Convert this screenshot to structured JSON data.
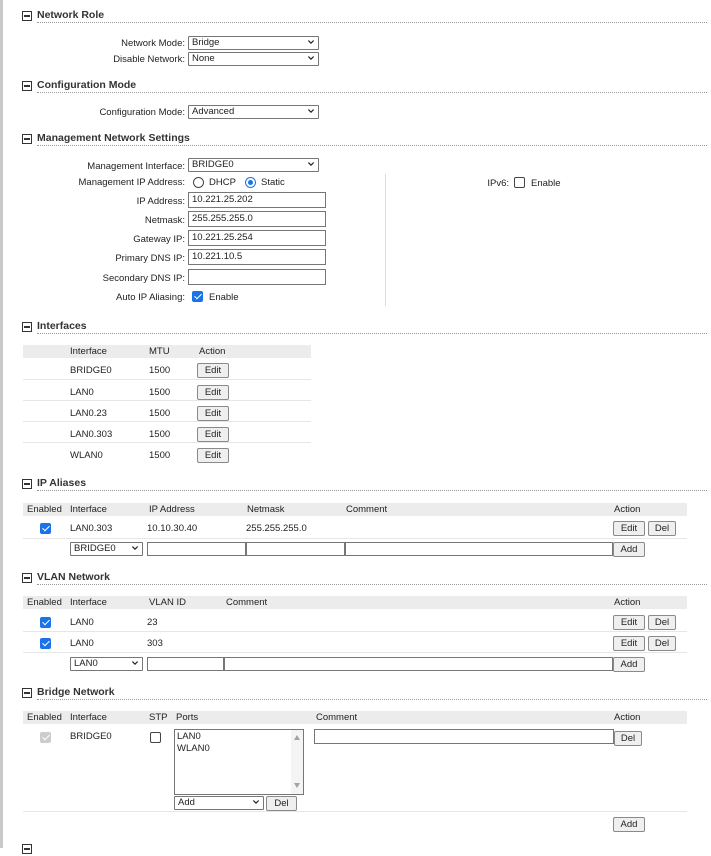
{
  "sections": {
    "network_role": "Network Role",
    "configuration_mode": "Configuration Mode",
    "management": "Management Network Settings",
    "interfaces": "Interfaces",
    "ip_aliases": "IP Aliases",
    "vlan": "VLAN Network",
    "bridge": "Bridge Network"
  },
  "network_role": {
    "network_mode_label": "Network Mode:",
    "network_mode": "Bridge",
    "disable_network_label": "Disable Network:",
    "disable_network": "None"
  },
  "configuration_mode": {
    "label": "Configuration Mode:",
    "value": "Advanced"
  },
  "management": {
    "interface_label": "Management Interface:",
    "interface": "BRIDGE0",
    "ip_mode_label": "Management IP Address:",
    "dhcp": "DHCP",
    "static": "Static",
    "ip_label": "IP Address:",
    "ip": "10.221.25.202",
    "netmask_label": "Netmask:",
    "netmask": "255.255.255.0",
    "gateway_label": "Gateway IP:",
    "gateway": "10.221.25.254",
    "dns1_label": "Primary DNS IP:",
    "dns1": "10.221.10.5",
    "dns2_label": "Secondary DNS IP:",
    "dns2": "",
    "aliasing_label": "Auto IP Aliasing:",
    "aliasing_enable": "Enable",
    "ipv6_label": "IPv6:",
    "ipv6_enable": "Enable"
  },
  "interfaces": {
    "headers": [
      "Interface",
      "MTU",
      "Action"
    ],
    "edit_label": "Edit",
    "rows": [
      {
        "name": "BRIDGE0",
        "mtu": "1500"
      },
      {
        "name": "LAN0",
        "mtu": "1500"
      },
      {
        "name": "LAN0.23",
        "mtu": "1500"
      },
      {
        "name": "LAN0.303",
        "mtu": "1500"
      },
      {
        "name": "WLAN0",
        "mtu": "1500"
      }
    ]
  },
  "ip_aliases": {
    "headers": [
      "Enabled",
      "Interface",
      "IP Address",
      "Netmask",
      "Comment",
      "Action"
    ],
    "row": {
      "interface": "LAN0.303",
      "ip": "10.10.30.40",
      "netmask": "255.255.255.0",
      "comment": ""
    },
    "edit_label": "Edit",
    "del_label": "Del",
    "add_label": "Add",
    "new_interface": "BRIDGE0"
  },
  "vlan": {
    "headers": [
      "Enabled",
      "Interface",
      "VLAN ID",
      "Comment",
      "Action"
    ],
    "rows": [
      {
        "interface": "LAN0",
        "vlan_id": "23"
      },
      {
        "interface": "LAN0",
        "vlan_id": "303"
      }
    ],
    "edit_label": "Edit",
    "del_label": "Del",
    "add_label": "Add",
    "new_interface": "LAN0"
  },
  "bridge": {
    "headers": [
      "Enabled",
      "Interface",
      "STP",
      "Ports",
      "Comment",
      "Action"
    ],
    "row": {
      "interface": "BRIDGE0",
      "ports": [
        "LAN0",
        "WLAN0"
      ]
    },
    "port_add": "Add",
    "del_label": "Del",
    "add_label": "Add"
  },
  "colors": {
    "accent": "#1a73e8",
    "header_bg": "#ececec"
  }
}
